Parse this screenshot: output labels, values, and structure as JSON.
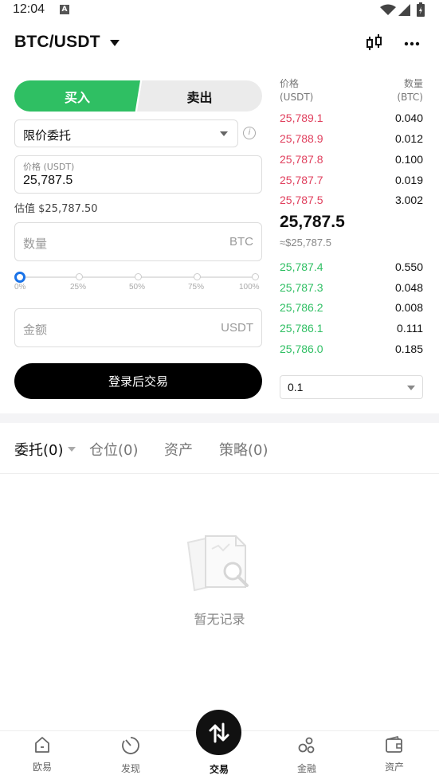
{
  "status_bar": {
    "time": "12:04",
    "notification": "A"
  },
  "header": {
    "pair": "BTC/USDT"
  },
  "trade": {
    "buy_label": "买入",
    "sell_label": "卖出",
    "order_type": "限价委托",
    "price_label": "价格 (USDT)",
    "price_value": "25,787.5",
    "estimate": "估值 $25,787.50",
    "qty_placeholder": "数量",
    "qty_unit": "BTC",
    "slider_marks": [
      "0%",
      "25%",
      "50%",
      "75%",
      "100%"
    ],
    "slider_value_percent": 0,
    "amount_placeholder": "金额",
    "amount_unit": "USDT",
    "login_button": "登录后交易"
  },
  "order_book": {
    "price_header": "价格",
    "price_unit": "(USDT)",
    "qty_header": "数量",
    "qty_unit": "(BTC)",
    "asks": [
      {
        "price": "25,789.1",
        "qty": "0.040"
      },
      {
        "price": "25,788.9",
        "qty": "0.012"
      },
      {
        "price": "25,787.8",
        "qty": "0.100"
      },
      {
        "price": "25,787.7",
        "qty": "0.019"
      },
      {
        "price": "25,787.5",
        "qty": "3.002"
      }
    ],
    "last_price": "25,787.5",
    "last_price_est": "≈$25,787.5",
    "bids": [
      {
        "price": "25,787.4",
        "qty": "0.550"
      },
      {
        "price": "25,787.3",
        "qty": "0.048"
      },
      {
        "price": "25,786.2",
        "qty": "0.008"
      },
      {
        "price": "25,786.1",
        "qty": "0.111"
      },
      {
        "price": "25,786.0",
        "qty": "0.185"
      }
    ],
    "depth": "0.1",
    "ask_color": "#e0405e",
    "bid_color": "#2fbf63"
  },
  "sub_tabs": [
    "委托(0)",
    "仓位(0)",
    "资产",
    "策略(0)"
  ],
  "empty_text": "暂无记录",
  "nav": {
    "items": [
      "欧易",
      "发现",
      "交易",
      "金融",
      "资产"
    ],
    "active": "交易"
  }
}
